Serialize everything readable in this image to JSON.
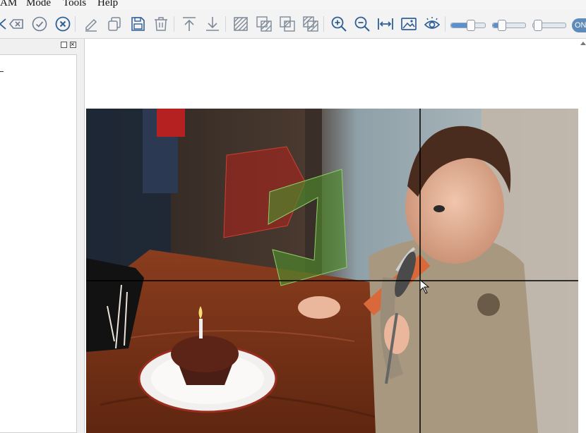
{
  "menu": {
    "items": [
      "AM",
      "Mode",
      "Tools",
      "Help"
    ]
  },
  "toolbar": {
    "toggle_label": "ON",
    "icons": [
      "close-box-icon",
      "check-circle-icon",
      "x-circle-icon",
      "pencil-icon",
      "copy-icon",
      "save-icon",
      "trash-icon",
      "move-top-icon",
      "move-bottom-icon",
      "hatch-layer-icon",
      "hatch-layers-icon",
      "overlap-icon",
      "overlap-all-icon",
      "zoom-in-icon",
      "zoom-out-icon",
      "fit-width-icon",
      "image-icon",
      "eye-icon"
    ],
    "sliders": [
      {
        "name": "brightness",
        "level": 0.55
      },
      {
        "name": "contrast",
        "level": 0.25
      },
      {
        "name": "opacity",
        "level": 0.05
      }
    ]
  },
  "colors": {
    "accent": "#2f5f97",
    "icon_blue": "#2f5f97",
    "red_polygon": "#b4231c",
    "green_polygon": "#4f8a2c",
    "crosshair": "#000000"
  }
}
